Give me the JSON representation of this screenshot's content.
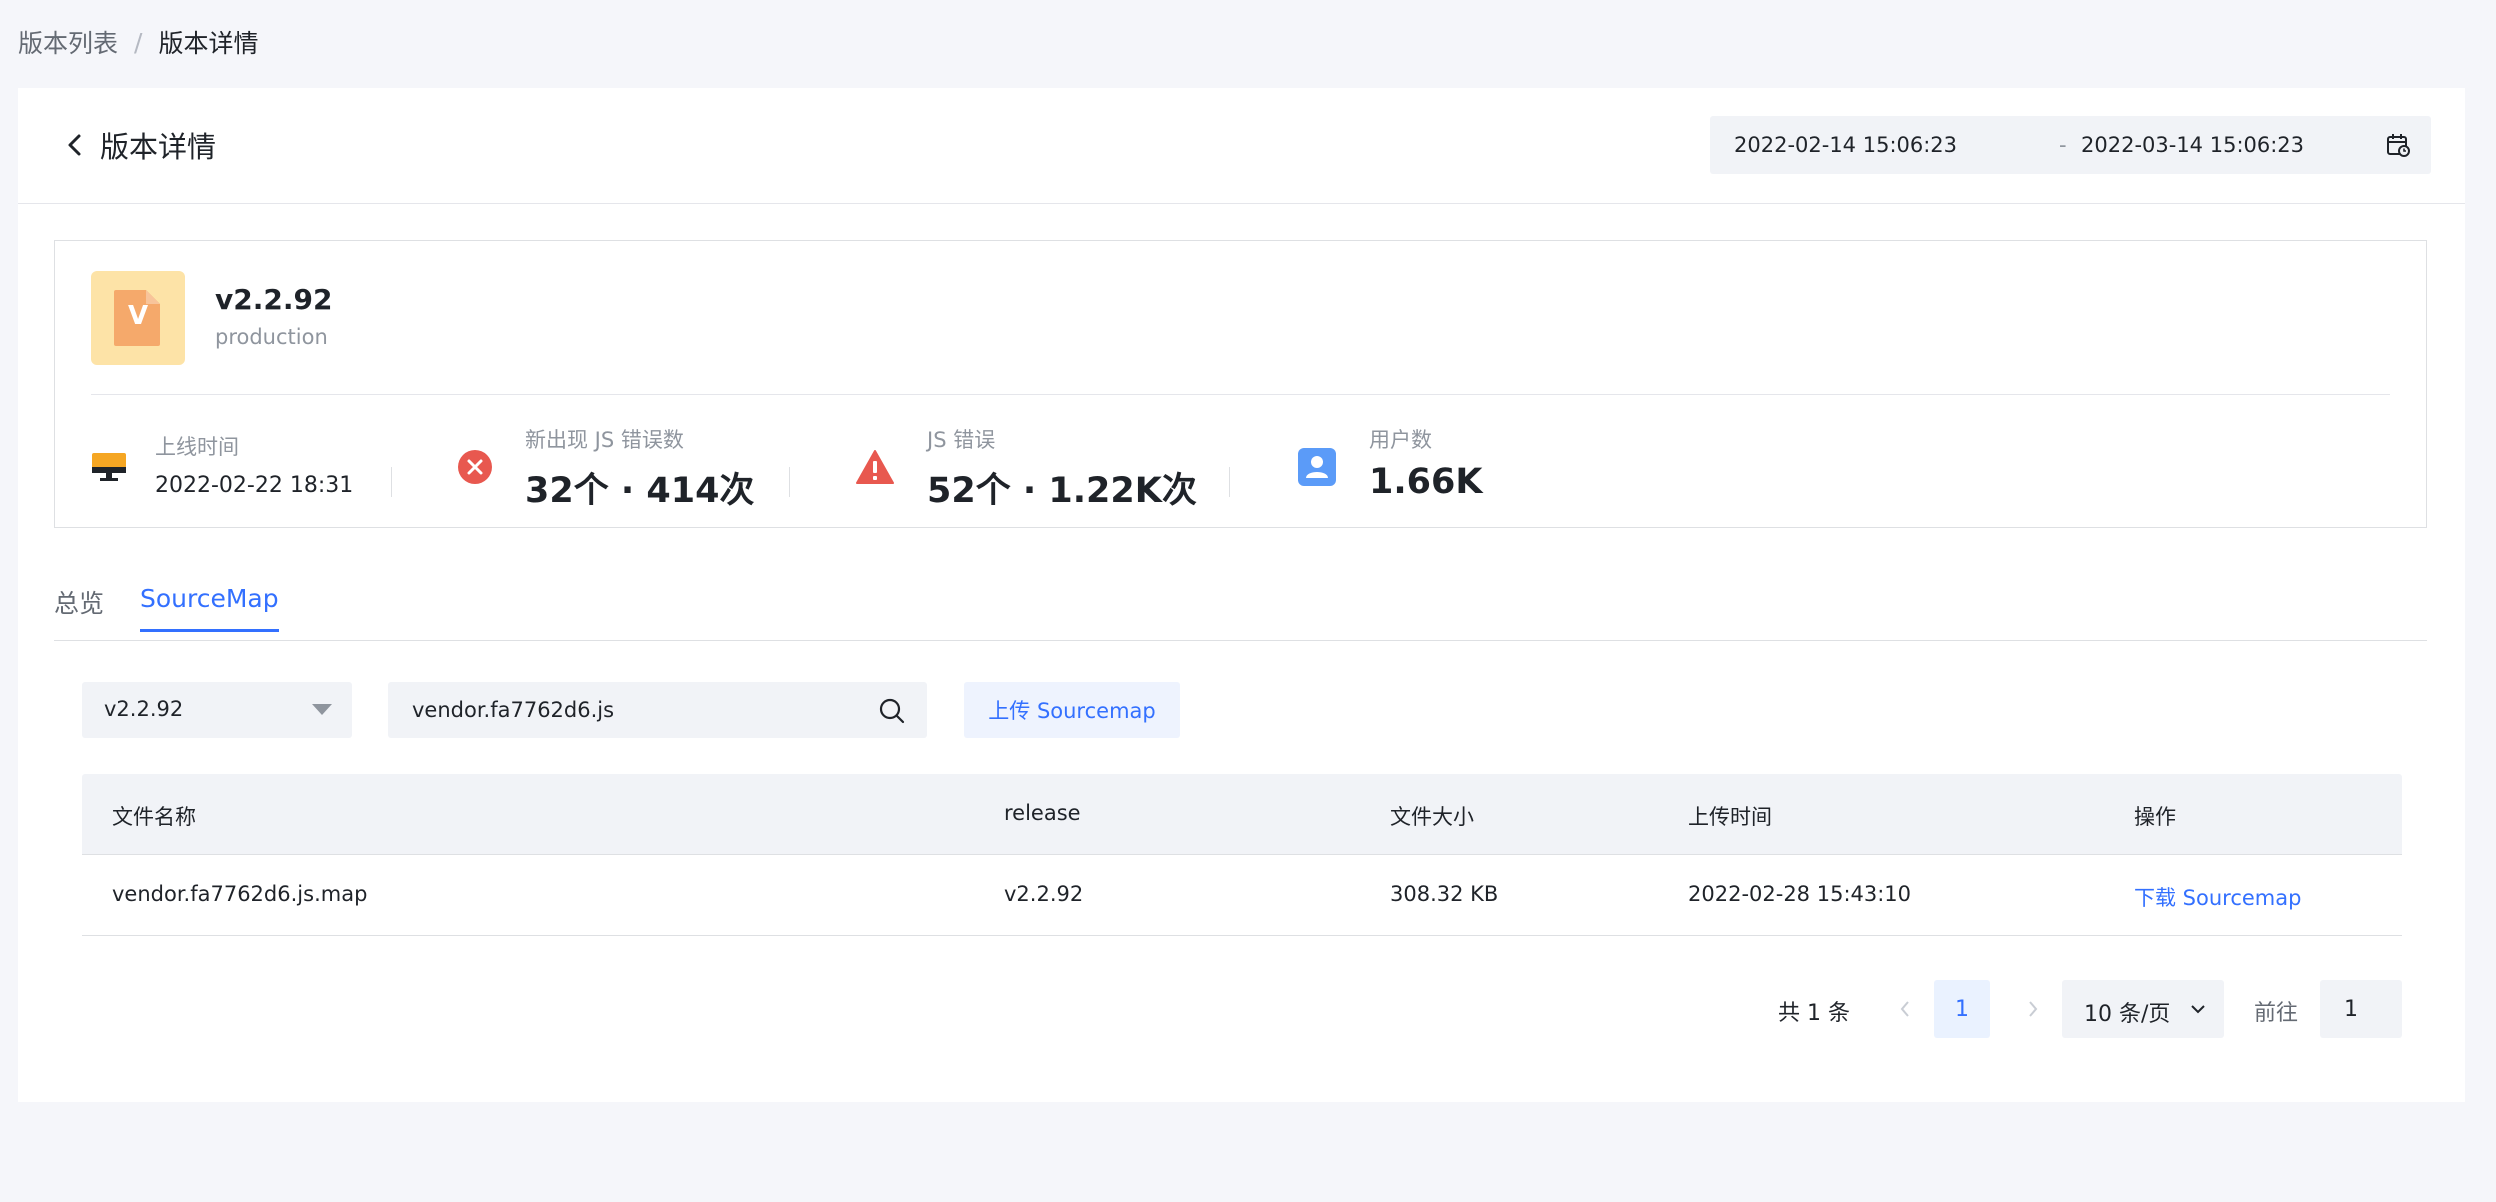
{
  "breadcrumb": {
    "parent": "版本列表",
    "separator": "/",
    "current": "版本详情"
  },
  "header": {
    "title": "版本详情",
    "date_range": {
      "start": "2022-02-14 15:06:23",
      "separator": "-",
      "end": "2022-03-14 15:06:23"
    }
  },
  "summary": {
    "version": "v2.2.92",
    "environment": "production",
    "logo_letter": "V",
    "stats": [
      {
        "label": "上线时间",
        "value": "2022-02-22 18:31",
        "icon": "monitor-icon"
      },
      {
        "label": "新出现 JS 错误数",
        "value": "32个 · 414次",
        "icon": "error-circle-icon"
      },
      {
        "label": "JS 错误",
        "value": "52个 · 1.22K次",
        "icon": "warning-triangle-icon"
      },
      {
        "label": "用户数",
        "value": "1.66K",
        "icon": "user-icon"
      }
    ]
  },
  "tabs": [
    {
      "label": "总览",
      "active": false
    },
    {
      "label": "SourceMap",
      "active": true
    }
  ],
  "filters": {
    "version_select": "v2.2.92",
    "search_value": "vendor.fa7762d6.js",
    "upload_label": "上传 Sourcemap"
  },
  "table": {
    "columns": [
      "文件名称",
      "release",
      "文件大小",
      "上传时间",
      "操作"
    ],
    "rows": [
      {
        "filename": "vendor.fa7762d6.js.map",
        "release": "v2.2.92",
        "size": "308.32 KB",
        "uploaded": "2022-02-28 15:43:10",
        "action": "下载 Sourcemap"
      }
    ]
  },
  "pagination": {
    "total": "共 1 条",
    "current_page": "1",
    "page_size": "10 条/页",
    "goto_label": "前往",
    "goto_value": "1"
  },
  "colors": {
    "accent": "#3370ff",
    "error": "#e8584f",
    "user_icon": "#5b9bf8",
    "monitor": "#f5a623"
  }
}
